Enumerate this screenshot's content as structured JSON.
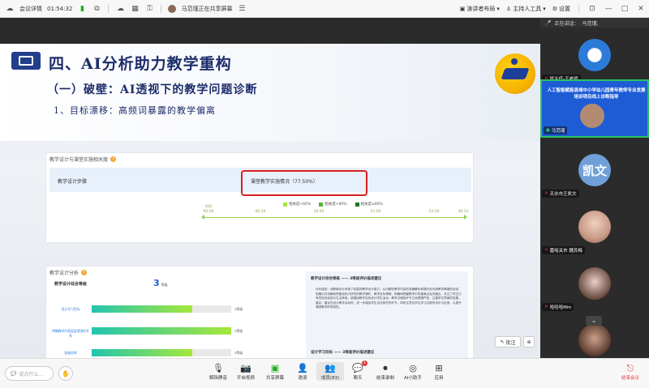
{
  "topbar": {
    "app_name": "会议详情",
    "timer": "01:54:32",
    "sharing_text": "马范瑾正在共享屏幕",
    "layout_label": "演讲者布局",
    "host_tools_label": "主持人工具",
    "settings_label": "设置"
  },
  "slide": {
    "title": "四、AI分析助力教学重构",
    "subtitle1": "（一）破壁：AI透视下的教学问题诊断",
    "subtitle2": "1、目标漂移：高频词暴露的教学偏离",
    "panel1": {
      "title": "教学设计与课堂实施相关度",
      "row_label": "教学设计步骤",
      "row_value": "课堂教学实施情况（77.50%）",
      "legend": [
        "相关度<60%",
        "相关度<80%",
        "相关度≥80%"
      ],
      "legend_colors": [
        "#a6e43a",
        "#56b832",
        "#1f7a1f"
      ],
      "timeline_start_label": "时间",
      "ticks": [
        "00:00",
        "00:20",
        "16:40",
        "25:00",
        "33:20",
        "38:31"
      ]
    },
    "panel2": {
      "title": "教学设计分析",
      "head_label": "教学设计综合等级",
      "count": "3",
      "count_unit": "等级",
      "bars": [
        {
          "label": "设计学习目标",
          "fill": 0.72,
          "tag": "3等级"
        },
        {
          "label": "明确教学内容层层递进的关系",
          "fill": 1.0,
          "tag": "3等级"
        },
        {
          "label": "逐级说明",
          "fill": 0.72,
          "tag": "3等级"
        }
      ],
      "right_title": "教学设计综合等级 —— 3等级评价描述建议",
      "right_text": "评价描述：该教案设计体现了较高的教学设计能力。从问题在教学内容的准确解析和提问设问到教学情境的创设、到展示并讲解其思路及执行研究的教学课件，教学目标清晰、明确和把握教学中的重难点及关键点，关注了学生已有的知识经验与生活体验，能围绕教学目标设计学生活动。教学过程各环节之间逻辑严密，注重学生思维的发展。建议：建议在设计教学活动时，进一步增加学生合作探究的环节，同时注意对学生学习过程的评价与反馈，以提升课堂教学的有效性。",
      "right_foot": "设计学习目标 —— 3等级评价描述建议"
    },
    "annotate_label": "批注"
  },
  "side": {
    "speaking_label": "正在讲话：",
    "speaking_name": "马范瑾;",
    "tiles": [
      {
        "name": "班主任-王老师"
      },
      {
        "name": "马范瑾",
        "banner": "人工智能赋能县域中小学幼儿园青年教师专业发展培训项目线上诊断指导"
      },
      {
        "name": "天水市王凯文",
        "avatar_text": "凯文"
      },
      {
        "name": "嘉峪关市 魏苏梅"
      },
      {
        "name": "哈哈哈Mm"
      }
    ]
  },
  "bottombar": {
    "chat_placeholder": "说点什么...",
    "tools": [
      {
        "label": "解除静音",
        "icon": "mic-off-icon"
      },
      {
        "label": "开启视频",
        "icon": "video-off-icon"
      },
      {
        "label": "共享屏幕",
        "icon": "share-screen-icon"
      },
      {
        "label": "邀请",
        "icon": "invite-icon"
      },
      {
        "label": "成员(83)",
        "icon": "members-icon"
      },
      {
        "label": "聊天",
        "icon": "chat-icon",
        "badge": "1"
      },
      {
        "label": "结束录制",
        "icon": "record-icon"
      },
      {
        "label": "AI小助手",
        "icon": "ai-assistant-icon"
      },
      {
        "label": "应用",
        "icon": "apps-icon"
      }
    ],
    "leave_label": "结束会议"
  }
}
